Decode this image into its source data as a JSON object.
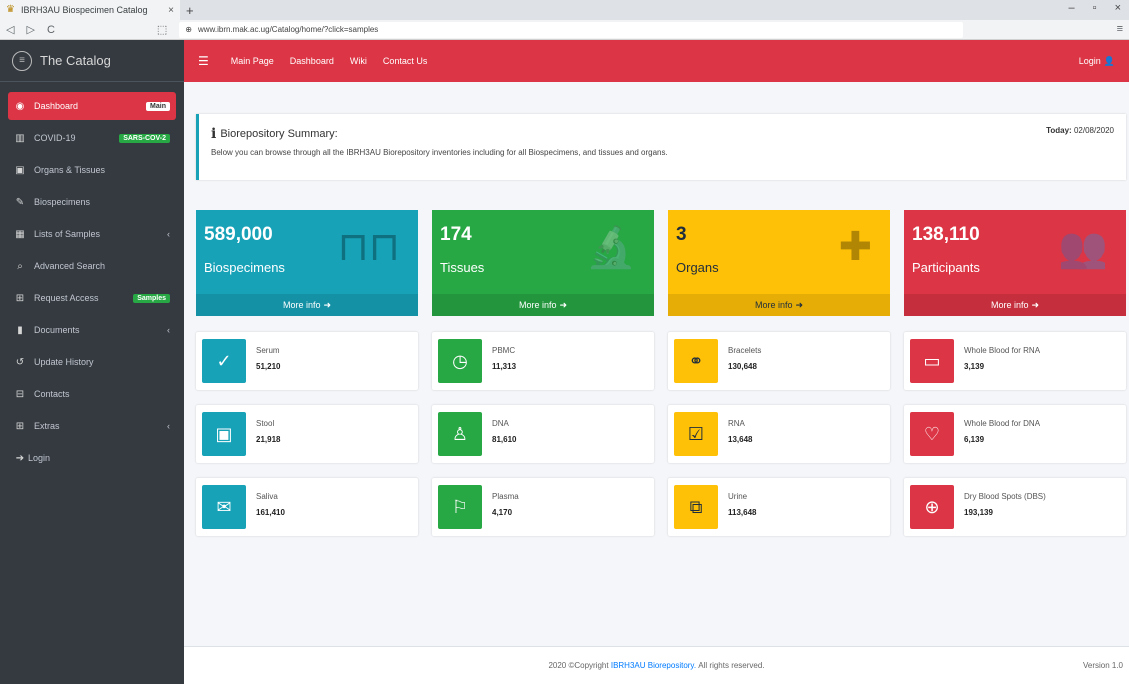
{
  "browser": {
    "tab_title": "IBRH3AU Biospecimen Catalog",
    "tab_close": "×",
    "new_tab": "+",
    "url": "www.ibrn.mak.ac.ug/Catalog/home/?click=samples",
    "win_min": "–",
    "win_max": "▫",
    "win_close": "×",
    "back": "◁",
    "forward": "▷",
    "reload": "C",
    "bookmark": "⬚",
    "menu": "≡"
  },
  "sidebar": {
    "brand": "The Catalog",
    "items": [
      {
        "label": "Dashboard",
        "icon": "dashboard-icon",
        "badge": "Main",
        "active": true
      },
      {
        "label": "COVID-19",
        "icon": "building-icon",
        "badge": "SARS-COV-2"
      },
      {
        "label": "Organs & Tissues",
        "icon": "briefcase-icon"
      },
      {
        "label": "Biospecimens",
        "icon": "pen-icon"
      },
      {
        "label": "Lists of Samples",
        "icon": "table-icon",
        "chevron": "‹"
      },
      {
        "label": "Advanced Search",
        "icon": "search-icon"
      },
      {
        "label": "Request Access",
        "icon": "cart-icon",
        "badge": "Samples"
      },
      {
        "label": "Documents",
        "icon": "file-icon",
        "chevron": "‹"
      },
      {
        "label": "Update History",
        "icon": "history-icon"
      },
      {
        "label": "Contacts",
        "icon": "contacts-icon"
      },
      {
        "label": "Extras",
        "icon": "extras-icon",
        "chevron": "‹"
      },
      {
        "label": "Login",
        "icon": "login-icon"
      }
    ]
  },
  "topnav": {
    "links": [
      "Main Page",
      "Dashboard",
      "Wiki",
      "Contact Us"
    ],
    "login": "Login"
  },
  "summary": {
    "title": "Biorepository Summary:",
    "description": "Below you can browse through all the IBRH3AU Biorepository inventories including for all Biospecimens, and tissues and organs.",
    "today_label": "Today:",
    "today_value": "02/08/2020"
  },
  "small_boxes": [
    {
      "number": "589,000",
      "label": "Biospecimens",
      "footer": "More info",
      "color": "#17a2b8",
      "icon": "test-tubes-icon"
    },
    {
      "number": "174",
      "label": "Tissues",
      "footer": "More info",
      "color": "#28a745",
      "icon": "microscope-icon"
    },
    {
      "number": "3",
      "label": "Organs",
      "footer": "More info",
      "color": "#ffc107",
      "icon": "medkit-icon"
    },
    {
      "number": "138,110",
      "label": "Participants",
      "footer": "More info",
      "color": "#dc3545",
      "icon": "users-icon"
    }
  ],
  "info_boxes": [
    {
      "text": "Serum",
      "value": "51,210",
      "color": "cyan",
      "icon": "check-circle-icon"
    },
    {
      "text": "PBMC",
      "value": "11,313",
      "color": "green",
      "icon": "clock-icon"
    },
    {
      "text": "Bracelets",
      "value": "130,648",
      "color": "yellow",
      "icon": "handshake-icon"
    },
    {
      "text": "Whole Blood for RNA",
      "value": "3,139",
      "color": "red",
      "icon": "folder-icon"
    },
    {
      "text": "Stool",
      "value": "21,918",
      "color": "cyan",
      "icon": "save-icon"
    },
    {
      "text": "DNA",
      "value": "81,610",
      "color": "green",
      "icon": "user-icon"
    },
    {
      "text": "RNA",
      "value": "13,648",
      "color": "yellow",
      "icon": "check-square-icon"
    },
    {
      "text": "Whole Blood for DNA",
      "value": "6,139",
      "color": "red",
      "icon": "heart-icon"
    },
    {
      "text": "Saliva",
      "value": "161,410",
      "color": "cyan",
      "icon": "envelope-icon"
    },
    {
      "text": "Plasma",
      "value": "4,170",
      "color": "green",
      "icon": "flag-icon"
    },
    {
      "text": "Urine",
      "value": "113,648",
      "color": "yellow",
      "icon": "copy-icon"
    },
    {
      "text": "Dry Blood Spots (DBS)",
      "value": "193,139",
      "color": "red",
      "icon": "lifebuoy-icon"
    }
  ],
  "footer": {
    "copyright": "2020 ©Copyright",
    "link": "IBRH3AU Biorepository.",
    "rights": "All rights reserved.",
    "version": "Version 1.0"
  }
}
